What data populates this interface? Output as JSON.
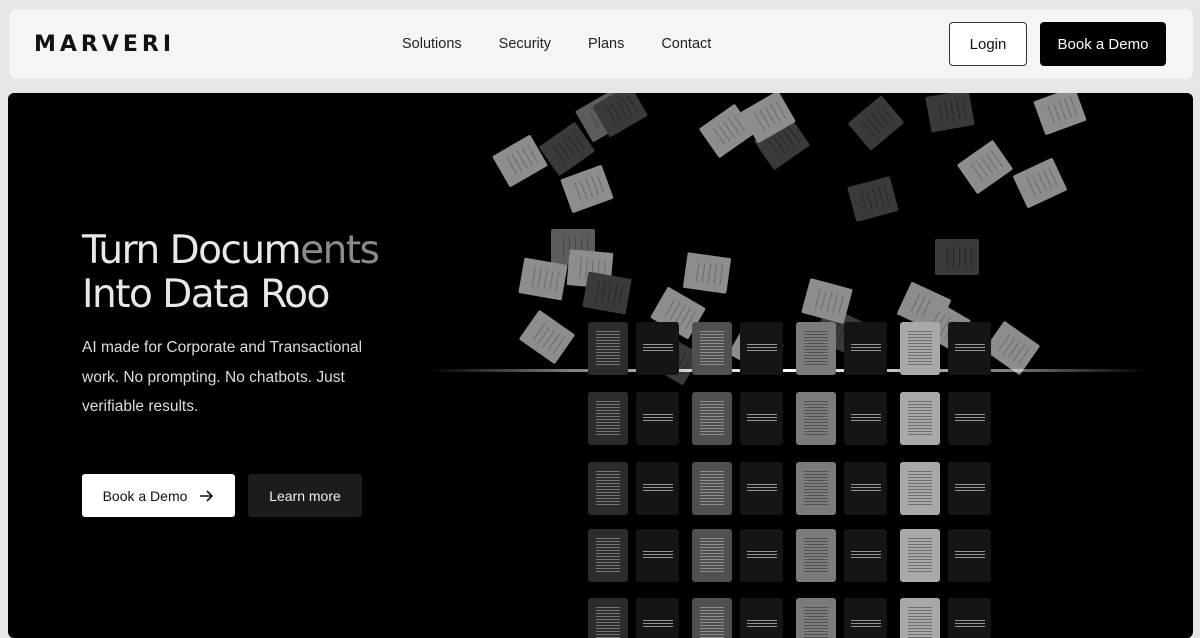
{
  "brand": {
    "logo": "MARVERI"
  },
  "nav": {
    "links": [
      "Solutions",
      "Security",
      "Plans",
      "Contact"
    ],
    "login_label": "Login",
    "demo_label": "Book a Demo"
  },
  "hero": {
    "title_line1_main": "Turn Docum",
    "title_line1_fade": "ents",
    "title_line2": "Into Data Roo",
    "subtitle": "AI made for Corporate and Transactional work. No prompting. No chatbots. Just verifiable results.",
    "primary_label": "Book a Demo",
    "secondary_label": "Learn more"
  },
  "colors": {
    "background": "#000000",
    "nav_bg": "#f5f5f5",
    "accent": "#ffffff"
  },
  "icons": {
    "primary_button": "arrow-right-icon"
  }
}
